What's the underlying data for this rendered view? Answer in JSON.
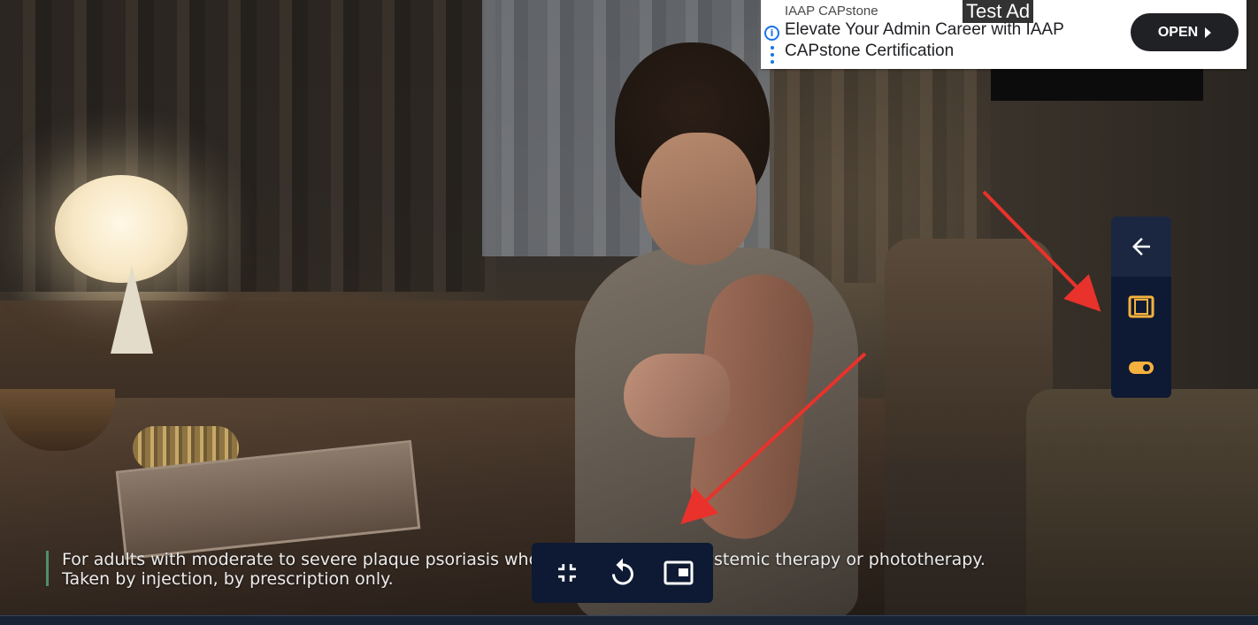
{
  "caption": {
    "line1": "For adults with moderate to severe plaque psoriasis who may benefit from systemic therapy or phototherapy.",
    "line2": "Taken by injection, by prescription only."
  },
  "ad": {
    "advertiser": "IAAP CAPstone",
    "badge": "Test Ad",
    "headline": "Elevate Your Admin Career with IAAP CAPstone Certification",
    "cta_label": "OPEN",
    "info_icon": "info-icon",
    "menu_icon": "more-vert-icon"
  },
  "side_toolbar": {
    "items": [
      {
        "icon": "arrow-left-icon"
      },
      {
        "icon": "aspect-frame-icon"
      },
      {
        "icon": "toggle-icon"
      }
    ]
  },
  "bottom_controls": {
    "items": [
      {
        "icon": "exit-fullscreen-icon"
      },
      {
        "icon": "replay-icon"
      },
      {
        "icon": "picture-in-picture-icon"
      }
    ]
  },
  "colors": {
    "toolbar_bg": "#0e1a33",
    "toolbar_active_bg": "#1b2740",
    "toggle_accent": "#f5b13d",
    "arrow_annotation": "#e8322b",
    "ad_link": "#1a73e8"
  }
}
